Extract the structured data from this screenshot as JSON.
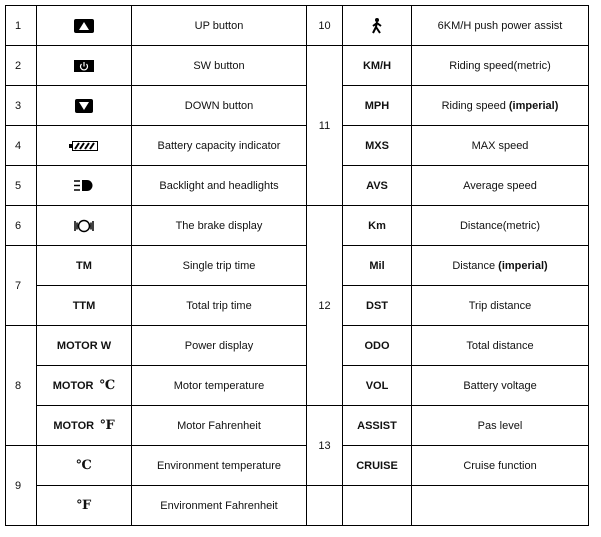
{
  "rows_left": [
    {
      "num": "1",
      "icon": "up-triangle-icon",
      "desc": "UP button"
    },
    {
      "num": "2",
      "icon": "power-icon",
      "desc": "SW button"
    },
    {
      "num": "3",
      "icon": "down-triangle-icon",
      "desc": "DOWN button"
    },
    {
      "num": "4",
      "icon": "battery-icon",
      "desc": "Battery capacity indicator"
    },
    {
      "num": "5",
      "icon": "headlight-icon",
      "desc": "Backlight and headlights"
    },
    {
      "num": "6",
      "icon": "brake-icon",
      "desc": "The brake display"
    },
    {
      "num": "7",
      "code": "TM",
      "desc": "Single trip time"
    },
    {
      "code": "TTM",
      "desc": "Total trip time"
    },
    {
      "num": "8",
      "code": "MOTOR W",
      "desc": "Power display"
    },
    {
      "code": "MOTOR",
      "unit": "℃",
      "desc": "Motor temperature"
    },
    {
      "code": "MOTOR",
      "unit": "℉",
      "desc": "Motor Fahrenheit"
    },
    {
      "num": "9",
      "unit": "℃",
      "desc": "Environment temperature"
    },
    {
      "unit": "℉",
      "desc": "Environment Fahrenheit"
    }
  ],
  "rows_right": [
    {
      "num": "10",
      "icon": "walking-person-icon",
      "desc": "6KM/H push power assist"
    },
    {
      "num": "11",
      "code": "KM/H",
      "desc": "Riding speed(metric)"
    },
    {
      "code": "MPH",
      "desc": "Riding speed ",
      "desc_bold": "(imperial)"
    },
    {
      "code": "MXS",
      "desc": "MAX speed"
    },
    {
      "code": "AVS",
      "desc": "Average speed"
    },
    {
      "num": "12",
      "code": "Km",
      "desc": "Distance(metric)"
    },
    {
      "code": "Mil",
      "desc": "Distance ",
      "desc_bold": "(imperial)"
    },
    {
      "code": "DST",
      "desc": "Trip distance"
    },
    {
      "code": "ODO",
      "desc": "Total distance"
    },
    {
      "code": "VOL",
      "desc": "Battery voltage"
    },
    {
      "num": "13",
      "code": "ASSIST",
      "desc": "Pas level"
    },
    {
      "code": "CRUISE",
      "desc": "Cruise function"
    }
  ]
}
